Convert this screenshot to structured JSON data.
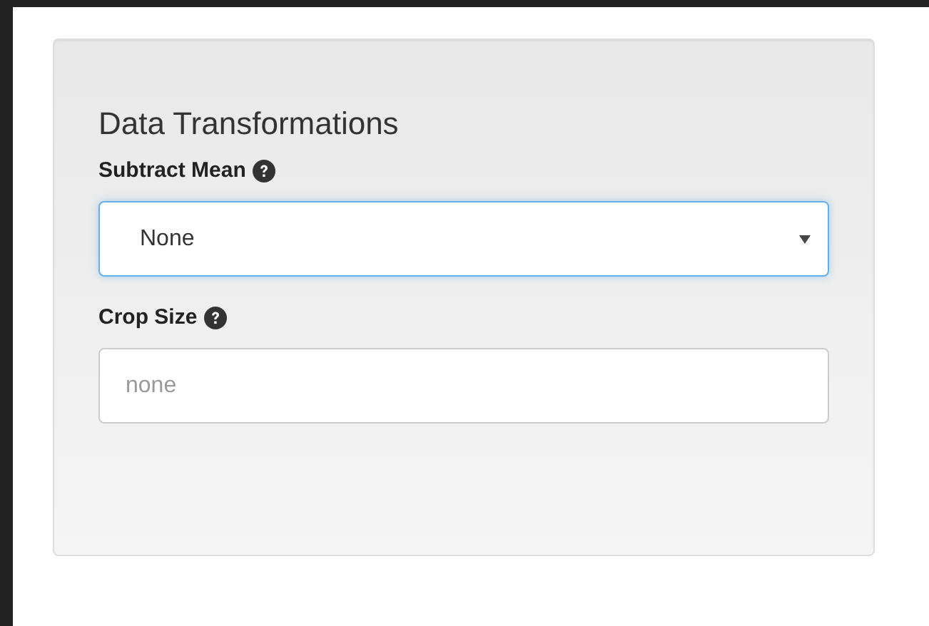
{
  "panel": {
    "title": "Data Transformations",
    "fields": [
      {
        "kind": "select",
        "label": "Subtract Mean",
        "value": "None",
        "focused": true
      },
      {
        "kind": "text",
        "label": "Crop Size",
        "placeholder": "none",
        "focused": false
      }
    ]
  }
}
